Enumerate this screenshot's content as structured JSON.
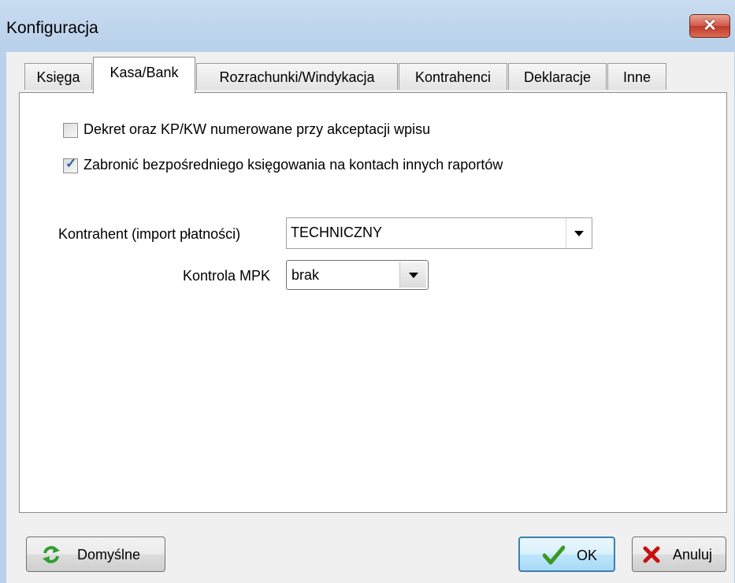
{
  "window": {
    "title": "Konfiguracja",
    "close_glyph": "✕"
  },
  "tabs": [
    {
      "label": "Księga"
    },
    {
      "label": "Kasa/Bank"
    },
    {
      "label": "Rozrachunki/Windykacja"
    },
    {
      "label": "Kontrahenci"
    },
    {
      "label": "Deklaracje"
    },
    {
      "label": "Inne"
    }
  ],
  "active_tab_index": 1,
  "options": {
    "dekret_label": "Dekret oraz KP/KW numerowane przy akceptacji wpisu",
    "dekret_checked": false,
    "zabronic_label": "Zabronić bezpośredniego księgowania na kontach innych raportów",
    "zabronic_checked": true,
    "check_glyph": "✓"
  },
  "fields": {
    "kontrahent_label": "Kontrahent (import płatności)",
    "kontrahent_value": "TECHNICZNY",
    "mpk_label": "Kontrola MPK",
    "mpk_value": "brak"
  },
  "buttons": {
    "domyslne": "Domyślne",
    "ok": "OK",
    "anuluj": "Anuluj"
  },
  "icons": {
    "refresh": "refresh-icon",
    "checkmark": "checkmark-icon",
    "cancel": "cancel-x-icon"
  },
  "colors": {
    "titlebar": "#b9d1ea",
    "close_button": "#c8412f",
    "check": "#3160a8",
    "ok_button": "#bee6fd",
    "refresh_icon": "#2f9e2f",
    "cancel_icon": "#c81010"
  }
}
